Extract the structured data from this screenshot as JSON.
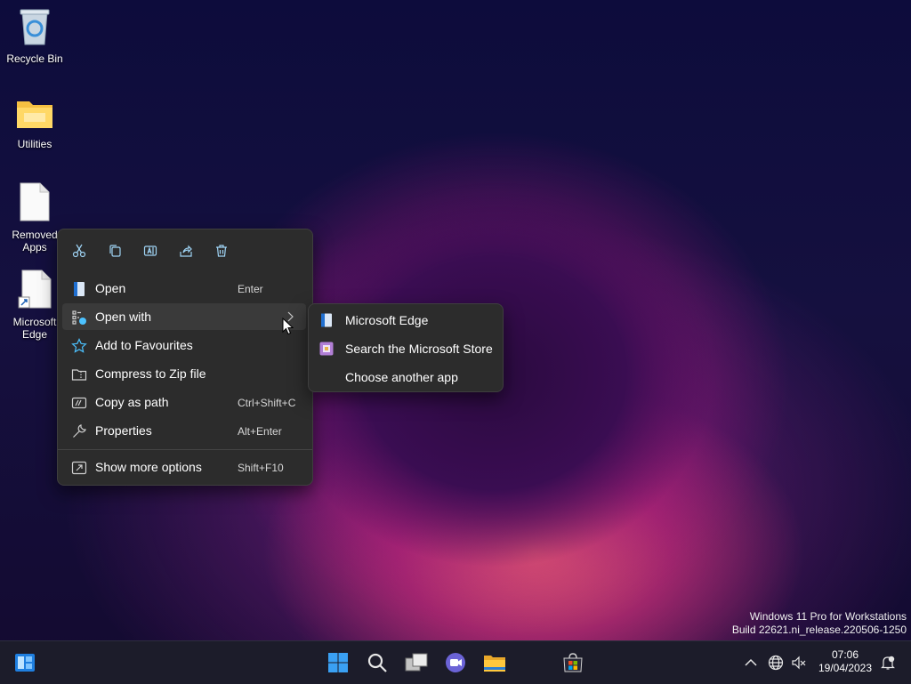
{
  "desktop": {
    "icons": [
      {
        "label": "Recycle Bin"
      },
      {
        "label": "Utilities"
      },
      {
        "label": "Removed Apps"
      },
      {
        "label": "Microsoft Edge"
      }
    ]
  },
  "context_menu": {
    "toolbar": [
      {
        "icon": "cut-icon"
      },
      {
        "icon": "copy-icon"
      },
      {
        "icon": "rename-icon"
      },
      {
        "icon": "share-icon"
      },
      {
        "icon": "delete-icon"
      }
    ],
    "items": [
      {
        "label": "Open",
        "shortcut": "Enter"
      },
      {
        "label": "Open with",
        "shortcut": ""
      },
      {
        "label": "Add to Favourites",
        "shortcut": ""
      },
      {
        "label": "Compress to Zip file",
        "shortcut": ""
      },
      {
        "label": "Copy as path",
        "shortcut": "Ctrl+Shift+C"
      },
      {
        "label": "Properties",
        "shortcut": "Alt+Enter"
      },
      {
        "label": "Show more options",
        "shortcut": "Shift+F10"
      }
    ],
    "submenu_arrow": ">"
  },
  "open_with_submenu": {
    "items": [
      {
        "label": "Microsoft Edge"
      },
      {
        "label": "Search the Microsoft Store"
      },
      {
        "label": "Choose another app"
      }
    ]
  },
  "watermark": {
    "line1": "Windows 11 Pro for Workstations",
    "line2": "Build 22621.ni_release.220506-1250"
  },
  "taskbar": {
    "time": "07:06",
    "date": "19/04/2023",
    "tray_chevron": "^"
  },
  "colors": {
    "menu_bg": "#2c2c2c",
    "accent": "#4cc2ff",
    "taskbar_bg": "#1c1c2a"
  }
}
